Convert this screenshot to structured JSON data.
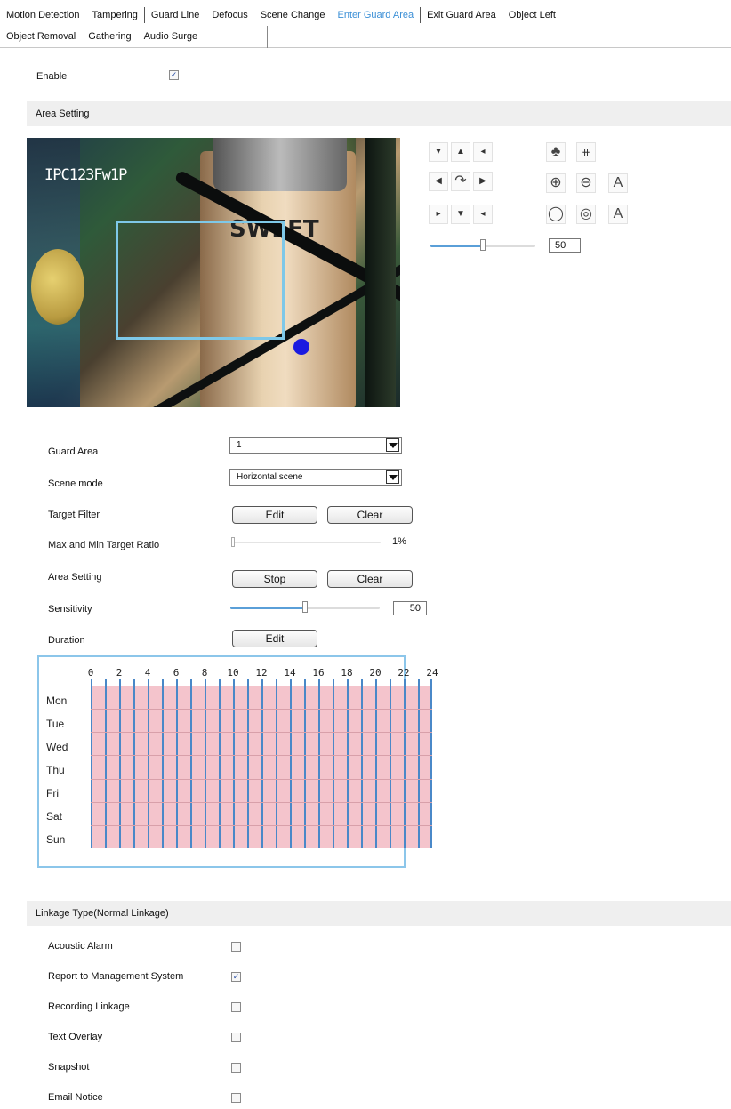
{
  "tabs": {
    "row1": [
      "Motion Detection",
      "Tampering",
      "Guard Line",
      "Defocus",
      "Scene Change",
      "Enter Guard Area",
      "Exit Guard Area",
      "Object Left"
    ],
    "row2": [
      "Object Removal",
      "Gathering",
      "Audio Surge"
    ],
    "active": "Enter Guard Area"
  },
  "enable": {
    "label": "Enable",
    "checked": true
  },
  "area_setting_header": "Area Setting",
  "video": {
    "osd_text": "IPC123Fw1P",
    "product_text": "SWEET"
  },
  "ptz": {
    "arrows": [
      "up-left",
      "up",
      "up-right",
      "left",
      "rotate",
      "right",
      "down-left",
      "down",
      "down-right"
    ],
    "tools": [
      "focus-near",
      "focus-far",
      "zoom-in",
      "zoom-out",
      "auto-focus",
      "iris-open",
      "iris-close",
      "auto-iris"
    ],
    "speed": "50",
    "speed_fraction": 0.5
  },
  "form": {
    "guard_area": {
      "label": "Guard Area",
      "value": "1"
    },
    "scene_mode": {
      "label": "Scene mode",
      "value": "Horizontal scene"
    },
    "target_filter": {
      "label": "Target Filter",
      "edit": "Edit",
      "clear": "Clear"
    },
    "target_ratio": {
      "label": "Max and Min Target Ratio",
      "value": "1%",
      "fraction": 0.01
    },
    "area_setting": {
      "label": "Area Setting",
      "stop": "Stop",
      "clear": "Clear"
    },
    "sensitivity": {
      "label": "Sensitivity",
      "value": "50",
      "fraction": 0.5
    },
    "duration": {
      "label": "Duration",
      "edit": "Edit"
    }
  },
  "schedule": {
    "hours": [
      "0",
      "2",
      "4",
      "6",
      "8",
      "10",
      "12",
      "14",
      "16",
      "18",
      "20",
      "22",
      "24"
    ],
    "days": [
      "Mon",
      "Tue",
      "Wed",
      "Thu",
      "Fri",
      "Sat",
      "Sun"
    ]
  },
  "linkage": {
    "header": "Linkage Type(Normal Linkage)",
    "items": [
      {
        "label": "Acoustic Alarm",
        "checked": false
      },
      {
        "label": "Report to Management System",
        "checked": true
      },
      {
        "label": "Recording Linkage",
        "checked": false
      },
      {
        "label": "Text Overlay",
        "checked": false
      },
      {
        "label": "Snapshot",
        "checked": false
      },
      {
        "label": "Email Notice",
        "checked": false
      }
    ]
  },
  "colors": {
    "active_tab": "#3b8fd6",
    "schedule_fill": "#f4c4cc",
    "schedule_line": "#4a88c8",
    "area_rect": "#7ec8e8"
  }
}
